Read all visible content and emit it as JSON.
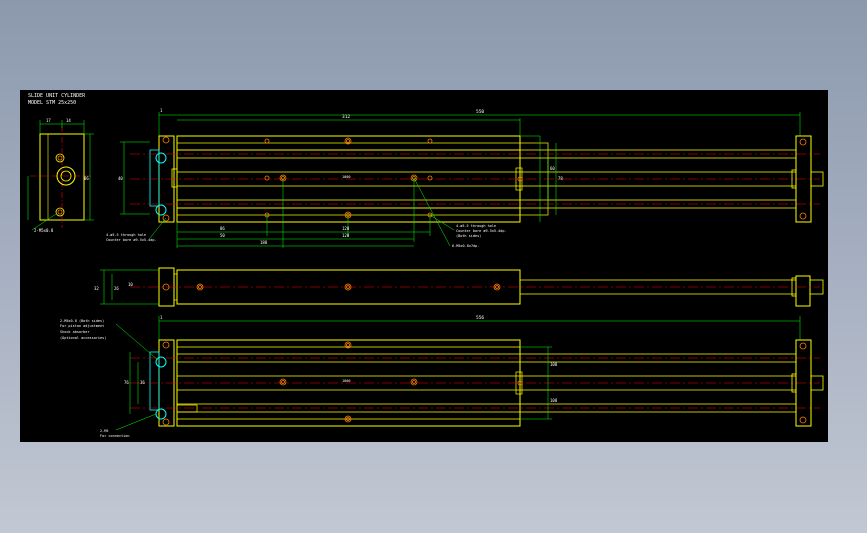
{
  "drawing": {
    "title_line1": "SLIDE UNIT CYLINDER",
    "title_line2": "MODEL STM 25x250",
    "colors": {
      "background": "#000000",
      "outline": "#ffff00",
      "dimension": "#00ff00",
      "centerline": "#ff0000",
      "hole": "#ff8000",
      "accent": "#00ffff",
      "text": "#ffffff"
    },
    "dims": {
      "end_gap_top": "1",
      "overall_top": "550",
      "body_len": "312",
      "sec_30": "30",
      "sec_120a": "120",
      "sec_120b": "120",
      "sec_50": "50",
      "sec_188": "188",
      "sec_86": "86",
      "sec_17": "17",
      "sec_14": "14",
      "sec_86b": "86",
      "h_40": "40",
      "h_17": "17",
      "h_60": "60",
      "h_78": "78",
      "h_32": "32",
      "h_26": "26",
      "h_10": "10",
      "h_550b": "556",
      "h_40b": "40",
      "h_76": "76",
      "h_48": "48",
      "h_108": "108",
      "h_108b": "108",
      "h_110": "110",
      "h_36": "36",
      "h_34": "34",
      "h_13": "13",
      "end_gap_bot": "1"
    },
    "notes": {
      "note_a1": "4-ø5.5 through hole",
      "note_a2": "Counter bore ø9.5x5.4dp.",
      "note_b1": "4-ø5.5 through hole",
      "note_b2": "Counter bore ø9.5x5.4dp.",
      "note_b3": "(Both sides)",
      "note_c": "6-M5x0.8x7dp.",
      "note_d": "2-M5x0.8",
      "note_e1": "2-M5x0.8 (Both sides)",
      "note_e2": "For piston adjustment",
      "note_e3": "Shock absorber",
      "note_e4": "(Optional accessories)",
      "note_f1": "2-M5",
      "note_f2": "For connection",
      "center_lbl1": "1000",
      "center_lbl2": "1000"
    }
  }
}
